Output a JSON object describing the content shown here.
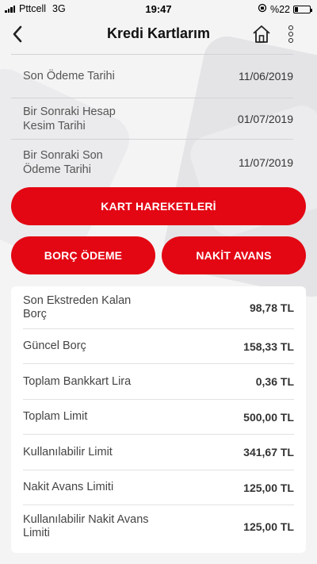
{
  "status_bar": {
    "carrier": "Pttcell",
    "network": "3G",
    "time": "19:47",
    "battery": "%22",
    "icons": [
      "signal-icon",
      "rotation-lock-icon",
      "battery-icon"
    ]
  },
  "nav": {
    "title": "Kredi Kartlarım",
    "icons": [
      "back-arrow-icon",
      "home-icon",
      "more-vertical-icon"
    ]
  },
  "card_info": [
    {
      "label": "Son Ödeme Tarihi",
      "value": "11/06/2019"
    },
    {
      "label": "Bir Sonraki Hesap Kesim Tarihi",
      "value": "01/07/2019"
    },
    {
      "label": "Bir Sonraki Son Ödeme Tarihi",
      "value": "11/07/2019"
    }
  ],
  "actions": {
    "kart_hareketleri": "KART HAREKETLERİ",
    "borc_odeme": "BORÇ ÖDEME",
    "nakit_avans": "NAKİT AVANS"
  },
  "summary": [
    {
      "label": "Son Ekstreden Kalan Borç",
      "value": "98,78 TL"
    },
    {
      "label": "Güncel Borç",
      "value": "158,33 TL"
    },
    {
      "label": "Toplam Bankkart Lira",
      "value": "0,36 TL"
    },
    {
      "label": "Toplam Limit",
      "value": "500,00 TL"
    },
    {
      "label": "Kullanılabilir Limit",
      "value": "341,67 TL"
    },
    {
      "label": "Nakit Avans Limiti",
      "value": "125,00 TL"
    },
    {
      "label": "Kullanılabilir Nakit Avans Limiti",
      "value": "125,00 TL"
    }
  ],
  "colors": {
    "accent": "#e30613",
    "background": "#f4f4f5",
    "card": "#ffffff"
  }
}
